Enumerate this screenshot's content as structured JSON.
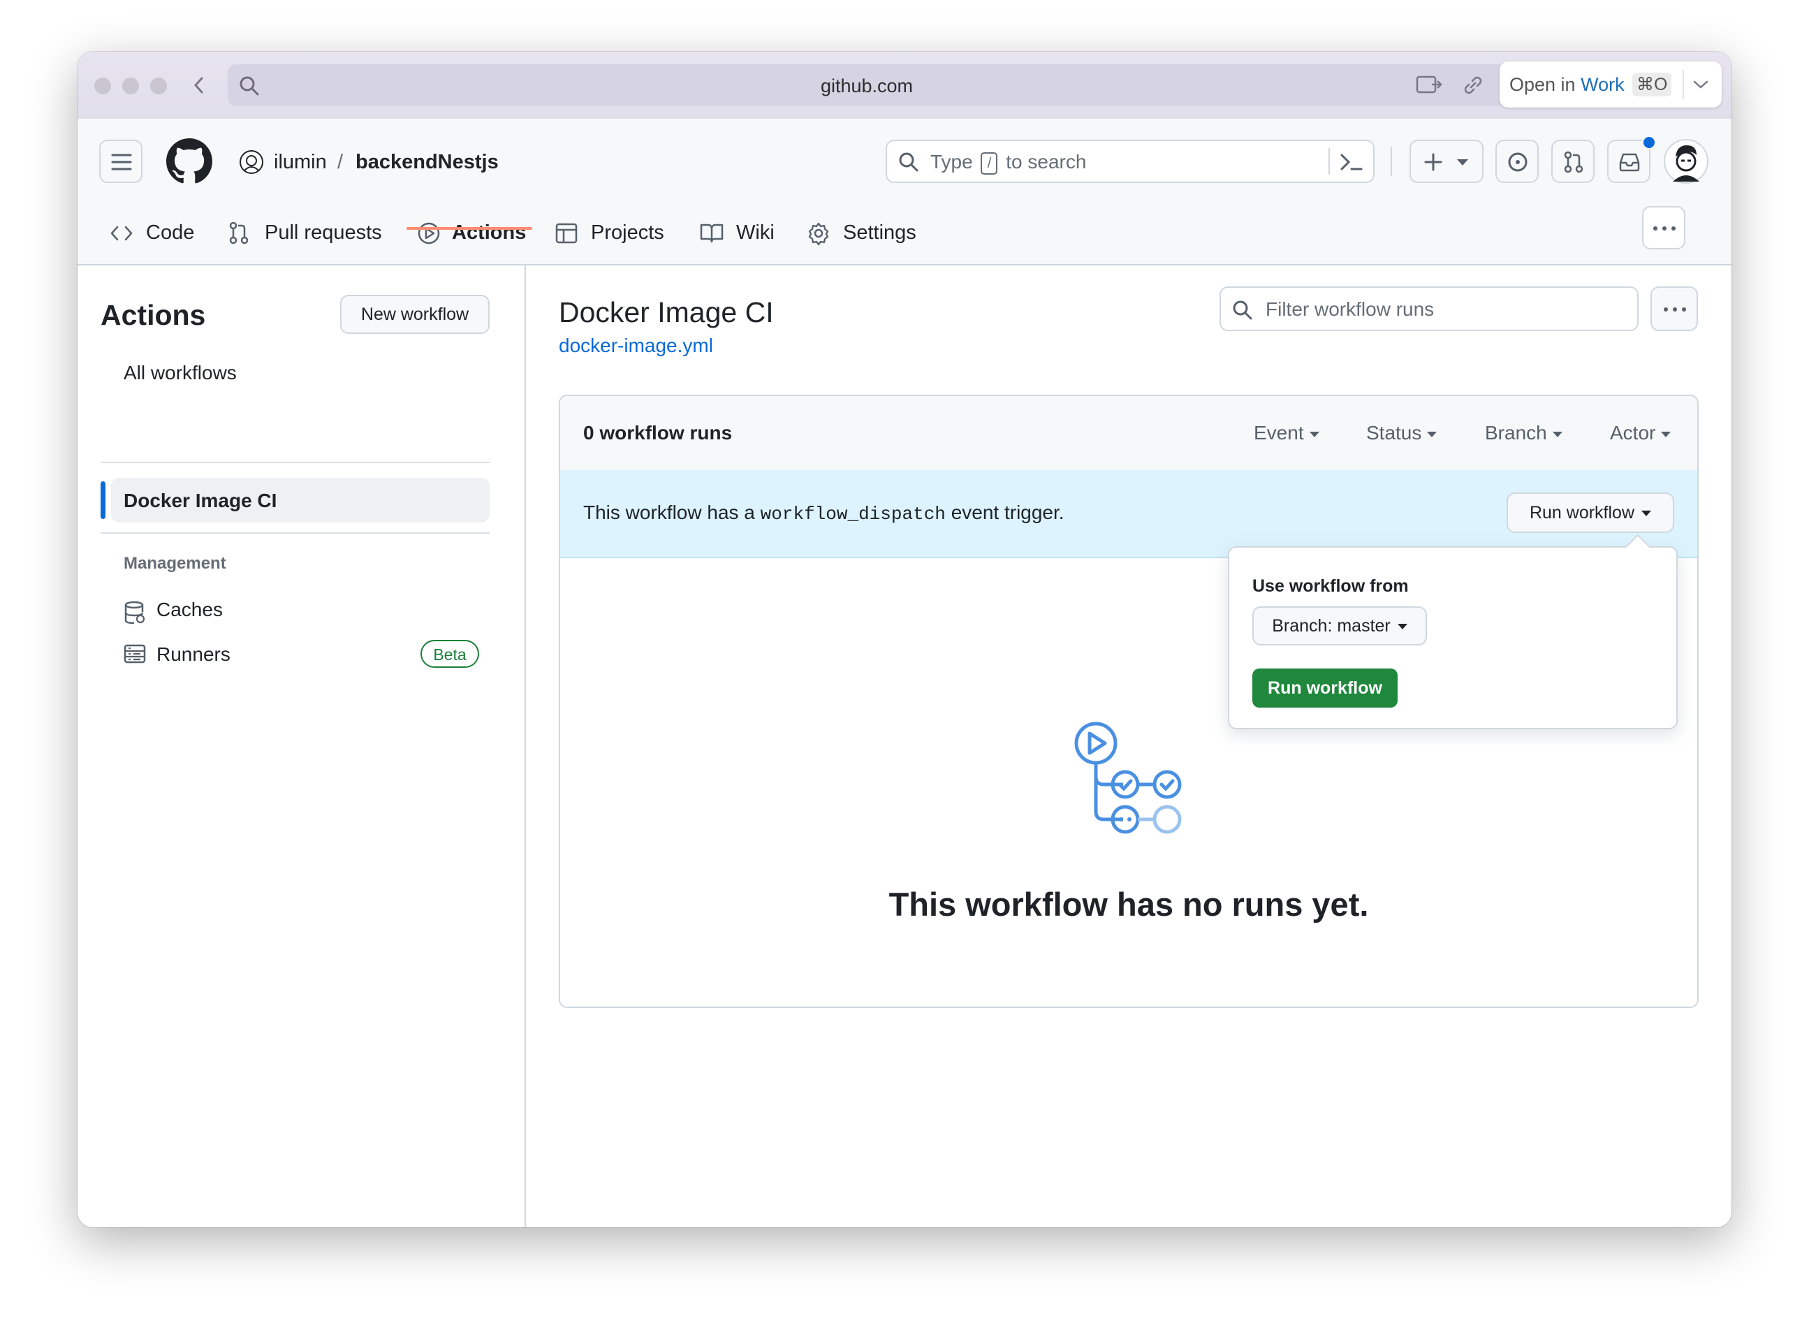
{
  "browser": {
    "url": "github.com",
    "open_in_prefix": "Open in",
    "open_in_target": "Work",
    "open_in_shortcut": "⌘O"
  },
  "header": {
    "owner": "ilumin",
    "separator": "/",
    "repo": "backendNestjs",
    "search_prefix": "Type",
    "search_key": "/",
    "search_suffix": "to search"
  },
  "tabs": [
    {
      "label": "Code",
      "icon": "code-icon"
    },
    {
      "label": "Pull requests",
      "icon": "pull-request-icon"
    },
    {
      "label": "Actions",
      "icon": "play-icon",
      "active": true
    },
    {
      "label": "Projects",
      "icon": "table-icon"
    },
    {
      "label": "Wiki",
      "icon": "book-icon"
    },
    {
      "label": "Settings",
      "icon": "gear-icon"
    }
  ],
  "sidebar": {
    "title": "Actions",
    "new_workflow": "New workflow",
    "all_workflows": "All workflows",
    "selected_workflow": "Docker Image CI",
    "management_heading": "Management",
    "caches": "Caches",
    "runners": "Runners",
    "runners_badge": "Beta"
  },
  "main": {
    "title": "Docker Image CI",
    "file_link": "docker-image.yml",
    "filter_placeholder": "Filter workflow runs",
    "runs_count": "0 workflow runs",
    "filters": [
      "Event",
      "Status",
      "Branch",
      "Actor"
    ],
    "dispatch_prefix": "This workflow has a",
    "dispatch_code": "workflow_dispatch",
    "dispatch_suffix": "event trigger.",
    "run_workflow_button": "Run workflow",
    "empty_message": "This workflow has no runs yet."
  },
  "popover": {
    "label": "Use workflow from",
    "branch_button": "Branch: master",
    "submit": "Run workflow"
  },
  "colors": {
    "accent_blue": "#0969da",
    "green_button": "#1f883d",
    "tab_underline": "#fd8c73",
    "notification_dot": "#0969da"
  }
}
